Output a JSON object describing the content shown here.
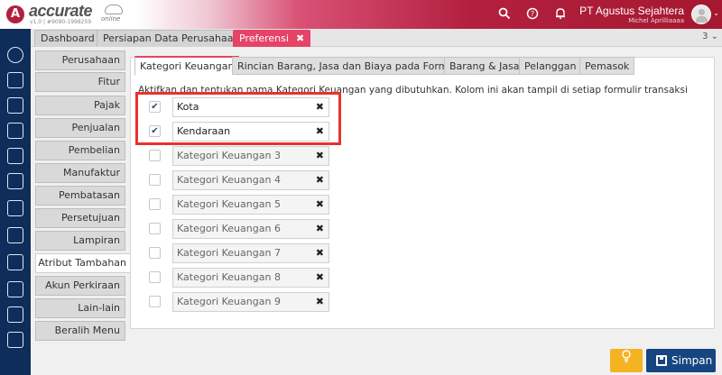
{
  "app": {
    "logo_letter": "A",
    "logo_name": "accurate",
    "logo_sub": "online",
    "version": "v1.0 | #9090-1998259",
    "company": "PT Agustus Sejahtera",
    "user": "Michel Aprilliaaaa"
  },
  "header_icons": [
    "search-icon",
    "help-icon",
    "bell-icon"
  ],
  "top_tabs": [
    {
      "label": "Dashboard"
    },
    {
      "label": "Persiapan Data Perusahaan"
    },
    {
      "label": "Preferensi",
      "close": "✖"
    }
  ],
  "tab_count": "3 ⌄",
  "left_tabs": [
    "Perusahaan",
    "Fitur",
    "Pajak",
    "Penjualan",
    "Pembelian",
    "Manufaktur",
    "Pembatasan",
    "Persetujuan",
    "Lampiran",
    "Atribut Tambahan",
    "Akun Perkiraan",
    "Lain-lain",
    "Beralih Menu"
  ],
  "inner_tabs": [
    "Kategori Keuangan",
    "Rincian Barang, Jasa dan Biaya pada Formulir",
    "Barang & Jasa",
    "Pelanggan",
    "Pemasok"
  ],
  "instruction": "Aktifkan dan tentukan nama Kategori Keuangan yang dibutuhkan. Kolom ini akan tampil di setiap formulir transaksi",
  "categories": [
    {
      "value": "Kota",
      "check": "✔"
    },
    {
      "value": "Kendaraan",
      "check": "✔"
    },
    {
      "value": "Kategori Keuangan 3",
      "check": ""
    },
    {
      "value": "Kategori Keuangan 4",
      "check": ""
    },
    {
      "value": "Kategori Keuangan 5",
      "check": ""
    },
    {
      "value": "Kategori Keuangan 6",
      "check": ""
    },
    {
      "value": "Kategori Keuangan 7",
      "check": ""
    },
    {
      "value": "Kategori Keuangan 8",
      "check": ""
    },
    {
      "value": "Kategori Keuangan 9",
      "check": ""
    }
  ],
  "clear_glyph": "✖",
  "buttons": {
    "save": "Simpan"
  },
  "colors": {
    "brand": "#b3203f",
    "active_tab": "#e64366",
    "sidebar": "#0e2d5b",
    "save": "#16457f",
    "highlight": "#e8322f",
    "lightbulb": "#f5b324"
  }
}
